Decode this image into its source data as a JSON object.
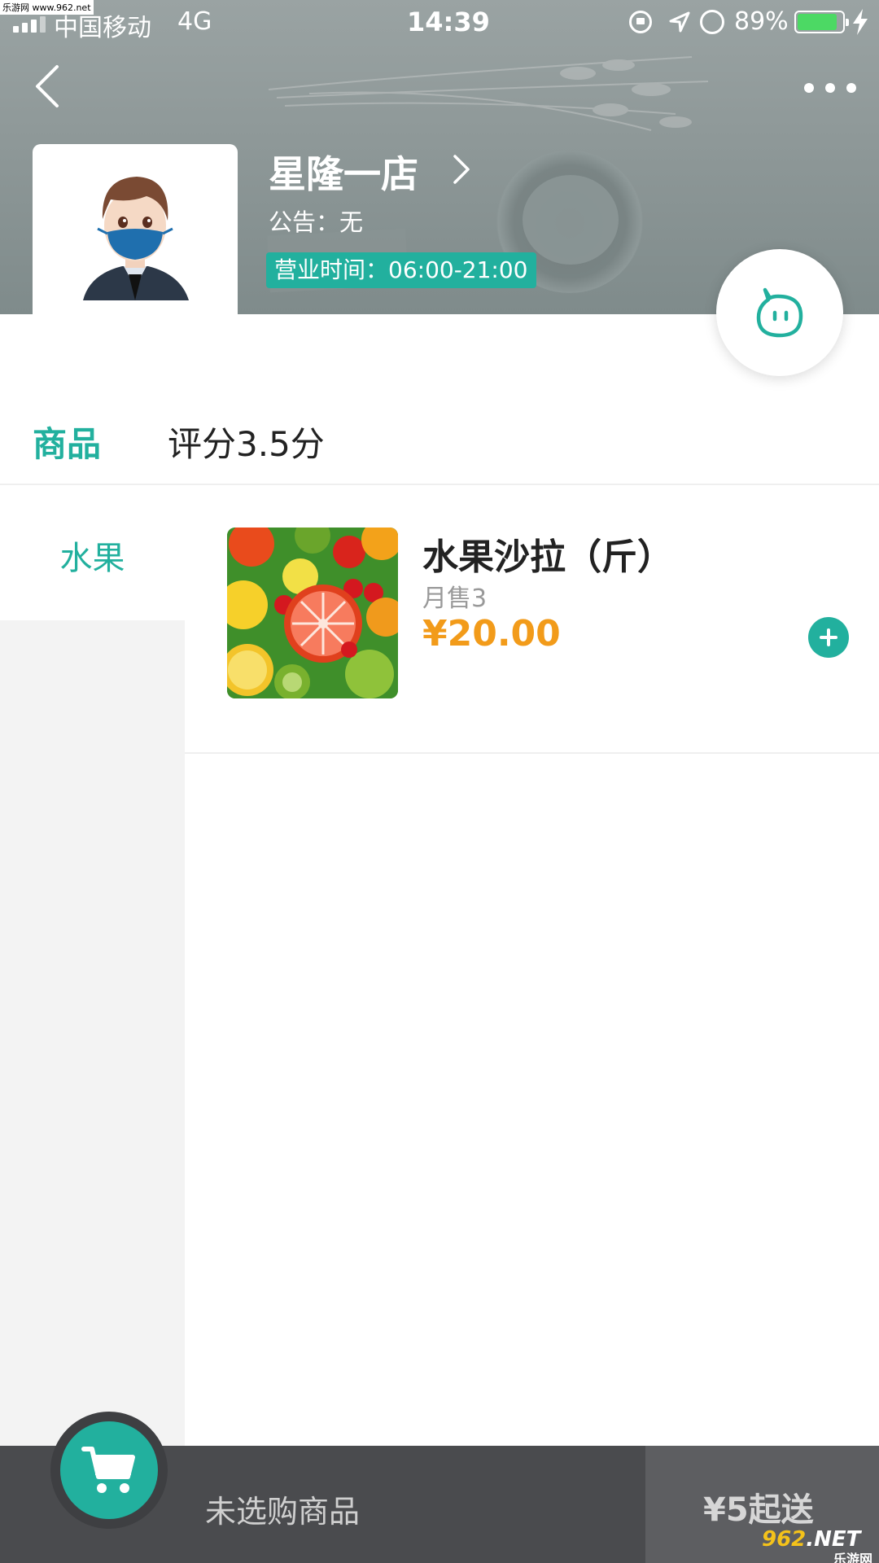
{
  "status_bar": {
    "carrier": "中国移动",
    "network": "4G",
    "time": "14:39",
    "battery_percent": "89%",
    "watermark": "乐游网 www.962.net"
  },
  "header": {
    "store_name": "星隆一店",
    "notice": "公告：无",
    "hours": "营业时间：06:00-21:00",
    "accent_color": "#22b09e"
  },
  "tabs": [
    {
      "label": "商品",
      "active": true
    },
    {
      "label": "评分3.5分",
      "active": false
    }
  ],
  "sidebar": {
    "items": [
      {
        "label": "水果",
        "active": true
      }
    ]
  },
  "products": [
    {
      "name": "水果沙拉（斤）",
      "sales": "月售3",
      "price": "¥20.00",
      "image": "fruit-salad-image"
    }
  ],
  "cart": {
    "status": "未选购商品",
    "min_delivery": "¥5起送"
  },
  "watermark_bottom": {
    "num": "962",
    "suffix": ".NET",
    "site": "乐游网"
  }
}
